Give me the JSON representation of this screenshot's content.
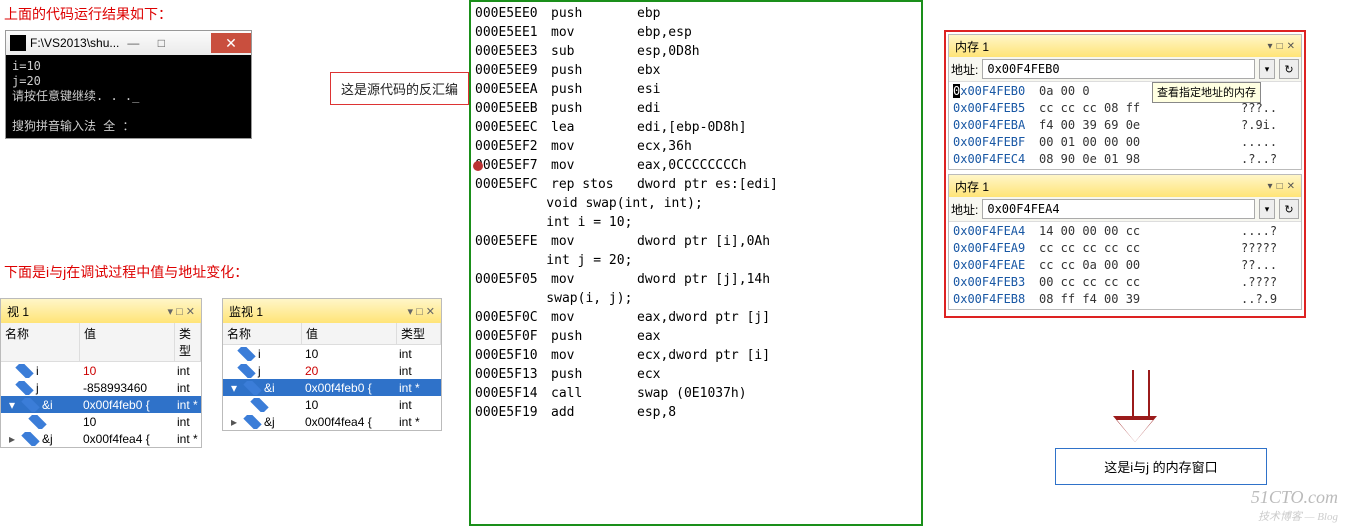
{
  "labels": {
    "top_caption": "上面的代码运行结果如下：",
    "src_label": "这是源代码的反汇编",
    "debug_caption": "下面是i与j在调试过程中值与地址变化：",
    "result_box": "这是i与j 的内存窗口"
  },
  "console": {
    "title": "F:\\VS2013\\shu...",
    "lines": [
      "i=10",
      "j=20",
      "请按任意键继续. . ._",
      "",
      "搜狗拼音输入法 全 ："
    ]
  },
  "watermark": {
    "main": "51CTO.com",
    "sub": "技术博客 — Blog"
  },
  "watch1_title": "视 1",
  "watch2_title": "监视 1",
  "watch_headers": {
    "name": "名称",
    "val": "值",
    "type": "类型"
  },
  "watch1": [
    {
      "g": "",
      "d": 0,
      "n": "i",
      "v": "10",
      "t": "int",
      "red": true
    },
    {
      "g": "",
      "d": 0,
      "n": "j",
      "v": "-858993460",
      "t": "int"
    },
    {
      "g": "▾",
      "d": 0,
      "n": "&i",
      "v": "0x00f4feb0 {",
      "t": "int *",
      "sel": true
    },
    {
      "g": "",
      "d": 1,
      "n": "",
      "v": "10",
      "t": "int"
    },
    {
      "g": "▸",
      "d": 0,
      "n": "&j",
      "v": "0x00f4fea4 {",
      "t": "int *"
    }
  ],
  "watch2": [
    {
      "g": "",
      "d": 0,
      "n": "i",
      "v": "10",
      "t": "int"
    },
    {
      "g": "",
      "d": 0,
      "n": "j",
      "v": "20",
      "t": "int",
      "red": true
    },
    {
      "g": "▾",
      "d": 0,
      "n": "&i",
      "v": "0x00f4feb0 {",
      "t": "int *",
      "sel": true
    },
    {
      "g": "",
      "d": 1,
      "n": "",
      "v": "10",
      "t": "int"
    },
    {
      "g": "▸",
      "d": 0,
      "n": "&j",
      "v": "0x00f4fea4 {",
      "t": "int *"
    }
  ],
  "disasm": [
    {
      "a": "000E5EE0",
      "o": "push",
      "x": "ebp"
    },
    {
      "a": "000E5EE1",
      "o": "mov",
      "x": "ebp,esp"
    },
    {
      "a": "000E5EE3",
      "o": "sub",
      "x": "esp,0D8h"
    },
    {
      "a": "000E5EE9",
      "o": "push",
      "x": "ebx"
    },
    {
      "a": "000E5EEA",
      "o": "push",
      "x": "esi"
    },
    {
      "a": "000E5EEB",
      "o": "push",
      "x": "edi"
    },
    {
      "a": "000E5EEC",
      "o": "lea",
      "x": "edi,[ebp-0D8h]"
    },
    {
      "a": "000E5EF2",
      "o": "mov",
      "x": "ecx,36h"
    },
    {
      "a": "000E5EF7",
      "o": "mov",
      "x": "eax,0CCCCCCCCh",
      "bp": true
    },
    {
      "a": "000E5EFC",
      "o": "rep stos",
      "x": "dword ptr es:[edi]"
    },
    {
      "src": "    void swap(int, int);"
    },
    {
      "src": "    int i = 10;"
    },
    {
      "a": "000E5EFE",
      "o": "mov",
      "x": "dword ptr [i],0Ah"
    },
    {
      "src": "    int j = 20;"
    },
    {
      "a": "000E5F05",
      "o": "mov",
      "x": "dword ptr [j],14h"
    },
    {
      "src": "    swap(i, j);"
    },
    {
      "a": "000E5F0C",
      "o": "mov",
      "x": "eax,dword ptr [j]"
    },
    {
      "a": "000E5F0F",
      "o": "push",
      "x": "eax"
    },
    {
      "a": "000E5F10",
      "o": "mov",
      "x": "ecx,dword ptr [i]"
    },
    {
      "a": "000E5F13",
      "o": "push",
      "x": "ecx"
    },
    {
      "a": "000E5F14",
      "o": "call",
      "x": "swap (0E1037h)"
    },
    {
      "a": "000E5F19",
      "o": "add",
      "x": "esp,8"
    }
  ],
  "mem_title": "内存 1",
  "mem_addr_label": "地址:",
  "mem1": {
    "addr": "0x00F4FEB0",
    "tooltip": "查看指定地址的内存",
    "rows": [
      {
        "a": "0x00F4FEB0",
        "h": "0a 00 0",
        "asc": "",
        "cur": true
      },
      {
        "a": "0x00F4FEB5",
        "h": "cc cc cc 08 ff",
        "asc": "???.."
      },
      {
        "a": "0x00F4FEBA",
        "h": "f4 00 39 69 0e",
        "asc": "?.9i."
      },
      {
        "a": "0x00F4FEBF",
        "h": "00 01 00 00 00",
        "asc": "....."
      },
      {
        "a": "0x00F4FEC4",
        "h": "08 90 0e 01 98",
        "asc": ".?..?"
      }
    ]
  },
  "mem2": {
    "addr": "0x00F4FEA4",
    "rows": [
      {
        "a": "0x00F4FEA4",
        "h": "14 00 00 00 cc",
        "asc": "....?"
      },
      {
        "a": "0x00F4FEA9",
        "h": "cc cc cc cc cc",
        "asc": "?????"
      },
      {
        "a": "0x00F4FEAE",
        "h": "cc cc 0a 00 00",
        "asc": "??..."
      },
      {
        "a": "0x00F4FEB3",
        "h": "00 cc cc cc cc",
        "asc": ".????"
      },
      {
        "a": "0x00F4FEB8",
        "h": "08 ff f4 00 39",
        "asc": "..?.9"
      }
    ]
  }
}
